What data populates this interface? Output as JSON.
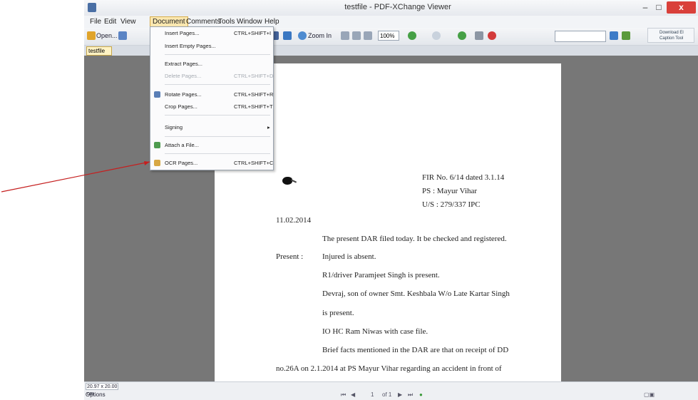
{
  "window": {
    "title": "testfile - PDF-XChange Viewer",
    "minimize": "–",
    "maximize": "□",
    "close": "x"
  },
  "menu": {
    "file": "File",
    "edit": "Edit",
    "view": "View",
    "document": "Document",
    "comments": "Comments",
    "tools": "Tools",
    "window": "Window",
    "help": "Help"
  },
  "toolbar": {
    "open": "Open...",
    "zoom_in": "Zoom In",
    "zoom": "100%",
    "help": "Download El Caption Tool"
  },
  "tab": {
    "name": "testfile"
  },
  "dropdown": {
    "items": [
      {
        "label": "Insert Pages...",
        "shortcut": "CTRL+SHIFT+I"
      },
      {
        "label": "Insert Empty Pages...",
        "shortcut": ""
      },
      {
        "label": "Extract Pages...",
        "shortcut": ""
      },
      {
        "label": "Delete Pages...",
        "shortcut": "CTRL+SHIFT+D"
      },
      {
        "label": "Rotate Pages...",
        "shortcut": "CTRL+SHIFT+R"
      },
      {
        "label": "Crop Pages...",
        "shortcut": "CTRL+SHIFT+T"
      },
      {
        "label": "Signing",
        "shortcut": ""
      },
      {
        "label": "Attach a File...",
        "shortcut": ""
      },
      {
        "label": "OCR Pages...",
        "shortcut": "CTRL+SHIFT+C"
      }
    ]
  },
  "document": {
    "fir": "FIR No. 6/14 dated 3.1.14",
    "ps": "PS : Mayur Vihar",
    "us": "U/S : 279/337 IPC",
    "date": "11.02.2014",
    "line1": "The present DAR filed today. It be checked and registered.",
    "present_label": "Present :",
    "present1": "Injured is absent.",
    "present2": "R1/driver Paramjeet Singh is present.",
    "present3": "Devraj, son of owner Smt. Keshbala W/o Late Kartar Singh",
    "present4": "is present.",
    "present5": "IO HC Ram Niwas with case file.",
    "present6": "Brief facts mentioned in the DAR are that on receipt of DD",
    "present7": "no.26A on 2.1.2014 at PS Mayur Vihar regarding an accident in front of"
  },
  "status": {
    "size": "20.97 x 20.00 cm",
    "options": "Options",
    "page": "1",
    "of_pages": "of 1"
  },
  "colors": {
    "viewer_bg": "#777777",
    "accent": "#d9403a",
    "menu_active": "#fbe8b0",
    "arrow": "#c51f1f"
  }
}
